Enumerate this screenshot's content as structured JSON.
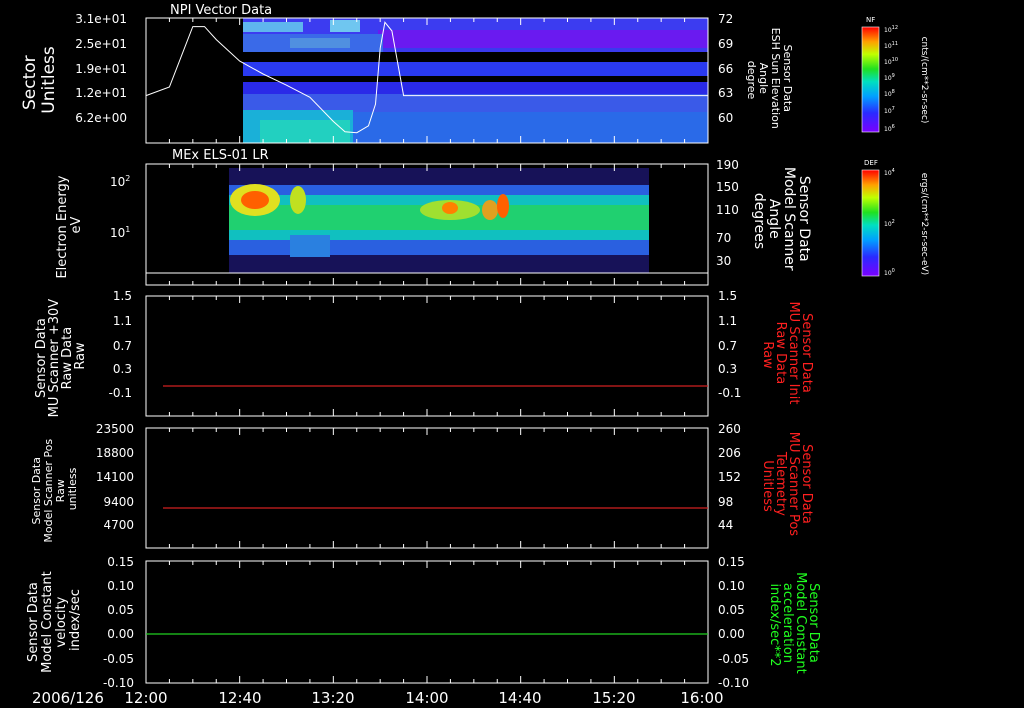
{
  "panels": [
    {
      "title": "NPI Vector Data",
      "left_label": [
        "Sector",
        "Unitless"
      ],
      "left_ticks": [
        "3.1e+01",
        "2.5e+01",
        "1.9e+01",
        "1.2e+01",
        "6.2e+00"
      ],
      "right_label": [
        "Sensor Data",
        "ESH Sun Elevation",
        "Angle",
        "degree"
      ],
      "right_ticks": [
        "72",
        "69",
        "66",
        "63",
        "60"
      ]
    },
    {
      "title": "MEx ELS-01 LR",
      "left_label": [
        "Electron Energy",
        "eV"
      ],
      "left_ticks": [
        "10",
        "10"
      ],
      "left_tick_exps": [
        "2",
        "1"
      ],
      "right_label": [
        "Sensor Data",
        "Model Scanner",
        "Angle",
        "degrees"
      ],
      "right_ticks": [
        "190",
        "150",
        "110",
        "70",
        "30"
      ]
    },
    {
      "title": "",
      "left_label": [
        "Sensor Data",
        "MU Scanner +30V",
        "Raw Data",
        "Raw"
      ],
      "left_ticks": [
        "1.5",
        "1.1",
        "0.7",
        "0.3",
        "-0.1"
      ],
      "right_label": [
        "Sensor Data",
        "MU Scanner Init",
        "Raw Data",
        "Raw"
      ],
      "right_ticks": [
        "1.5",
        "1.1",
        "0.7",
        "0.3",
        "-0.1"
      ]
    },
    {
      "title": "",
      "left_label": [
        "Sensor Data",
        "Model Scanner Pos",
        "Raw",
        "unitless"
      ],
      "left_ticks": [
        "23500",
        "18800",
        "14100",
        "9400",
        "4700"
      ],
      "right_label": [
        "Sensor Data",
        "MU Scanner Pos",
        "Telemetry",
        "Unitless"
      ],
      "right_ticks": [
        "260",
        "206",
        "152",
        "98",
        "44"
      ]
    },
    {
      "title": "",
      "left_label": [
        "Sensor Data",
        "Model Constant",
        "velocity",
        "index/sec"
      ],
      "left_ticks": [
        "0.15",
        "0.10",
        "0.05",
        "0.00",
        "-0.05",
        "-0.10"
      ],
      "right_label": [
        "Sensor Data",
        "Model Constant",
        "acceleration",
        "index/sec**2"
      ],
      "right_ticks": [
        "0.15",
        "0.10",
        "0.05",
        "0.00",
        "-0.05",
        "-0.10"
      ]
    }
  ],
  "x_axis": {
    "date": "2006/126",
    "ticks": [
      "12:00",
      "12:40",
      "13:20",
      "14:00",
      "14:40",
      "15:20",
      "16:00"
    ]
  },
  "colorbars": [
    {
      "name": "NF",
      "units": "cnts/(cm**2-sr-sec)",
      "ticks": [
        "10",
        "10",
        "10",
        "10",
        "10",
        "10",
        "10"
      ],
      "tick_exps": [
        "12",
        "11",
        "10",
        "9",
        "8",
        "7",
        "6"
      ]
    },
    {
      "name": "DEF",
      "units": "ergs/(cm**2-sr-sec-eV)",
      "ticks": [
        "10",
        "10",
        "10"
      ],
      "tick_exps": [
        "4",
        "2",
        "0"
      ]
    }
  ],
  "colors": {
    "red_trace": "#d02020",
    "green_trace": "#20d020",
    "right_label_panel3": "#ff2020",
    "right_label_panel5": "#20ff20"
  },
  "chart_data": [
    {
      "type": "heatmap",
      "title": "NPI Vector Data",
      "x_range": [
        "12:00",
        "16:00"
      ],
      "data_extent_x": [
        "12:40",
        "16:00"
      ],
      "y_ticks": [
        "3.1e+01",
        "2.5e+01",
        "1.9e+01",
        "1.2e+01",
        "6.2e+00"
      ],
      "overlay_series": {
        "name": "ESH Sun Elevation Angle",
        "x": [
          "12:00",
          "12:10",
          "12:15",
          "12:20",
          "12:25",
          "12:30",
          "12:40",
          "12:50",
          "13:00",
          "13:10",
          "13:20",
          "13:25",
          "13:30",
          "13:35",
          "13:38",
          "13:40",
          "13:42",
          "13:45",
          "13:50",
          "14:00",
          "15:00",
          "16:00"
        ],
        "y": [
          63.0,
          64.0,
          67.5,
          71.0,
          71.0,
          69.5,
          67.0,
          65.5,
          64.2,
          62.8,
          60.0,
          58.8,
          58.7,
          59.5,
          62.0,
          68.5,
          71.5,
          70.5,
          63.0,
          63.0,
          63.0,
          63.0
        ],
        "ylim": [
          57.5,
          72
        ]
      }
    },
    {
      "type": "heatmap",
      "title": "MEx ELS-01 LR",
      "x_range": [
        "12:00",
        "16:00"
      ],
      "data_extent_x": [
        "12:35",
        "15:30"
      ],
      "y_scale": "log",
      "overlay_series": {
        "name": "Model Scanner Angle",
        "x": [
          "12:00",
          "16:00"
        ],
        "y": [
          10,
          10
        ],
        "ylim": [
          0,
          190
        ]
      }
    },
    {
      "type": "line",
      "x": [
        "12:05",
        "16:00"
      ],
      "series": [
        {
          "name": "MU Scanner Init Raw Data",
          "values": [
            0.0,
            0.0
          ]
        }
      ],
      "ylim": [
        -0.3,
        1.5
      ]
    },
    {
      "type": "line",
      "x": [
        "12:05",
        "16:00"
      ],
      "series": [
        {
          "name": "MU Scanner Pos Telemetry",
          "values": [
            89,
            89
          ]
        }
      ],
      "ylim": [
        0,
        260
      ]
    },
    {
      "type": "line",
      "x": [
        "12:00",
        "16:00"
      ],
      "series": [
        {
          "name": "Model Constant acceleration",
          "values": [
            0.0,
            0.0
          ]
        }
      ],
      "ylim": [
        -0.1,
        0.15
      ]
    }
  ]
}
